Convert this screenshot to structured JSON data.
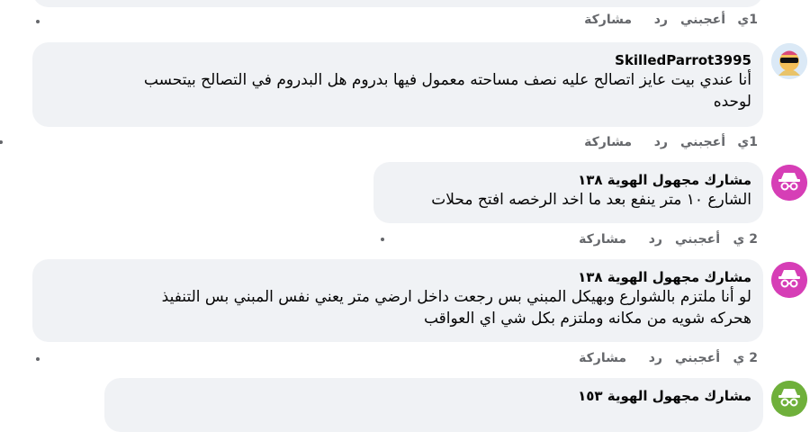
{
  "actions": {
    "like": "أعجبني",
    "reply": "رد",
    "share": "مشاركة"
  },
  "top_row": {
    "time": "1ي"
  },
  "comments": [
    {
      "author": "SkilledParrot3995",
      "lines": [
        "أنا عندي بيت عايز اتصالح عليه نصف مساحته معمول فيها بدروم هل البدروم في التصالح بيتحسب",
        "لوحده"
      ],
      "time": "1ي",
      "avatar": "parrot-avatar"
    },
    {
      "author": "مشارك مجهول الهوية ١٣٨",
      "lines": [
        "الشارع ١٠ متر ينفع بعد ما اخد الرخصه افتح محلات"
      ],
      "time": "2 ي",
      "avatar": "anonymous-avatar"
    },
    {
      "author": "مشارك مجهول الهوية ١٣٨",
      "lines": [
        "لو أنا ملتزم بالشوارع وبهيكل المبني بس رجعت داخل ارضي متر يعني نفس المبني بس التنفيذ",
        "هحركه شويه من مكانه وملتزم بكل شي اي العواقب"
      ],
      "time": "2 ي",
      "avatar": "anonymous-avatar"
    },
    {
      "author": "مشارك مجهول الهوية ١٥٣",
      "avatar": "anonymous-avatar"
    }
  ]
}
